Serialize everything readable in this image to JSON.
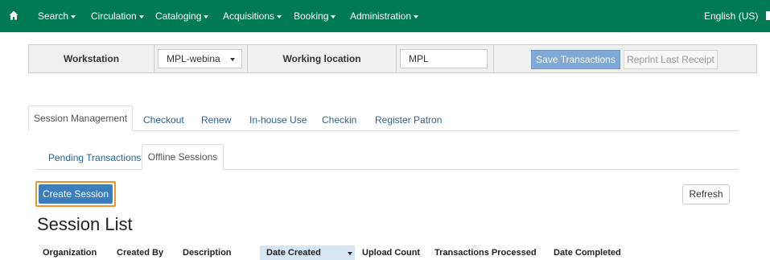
{
  "navbar": {
    "menus": [
      {
        "label": "Search"
      },
      {
        "label": "Circulation"
      },
      {
        "label": "Cataloging"
      },
      {
        "label": "Acquisitions"
      },
      {
        "label": "Booking"
      },
      {
        "label": "Administration"
      }
    ],
    "language": "English (US)"
  },
  "workstation_bar": {
    "workstation_label": "Workstation",
    "workstation_value": "MPL-webina",
    "working_location_label": "Working location",
    "working_location_value": "MPL",
    "save_button": "Save Transactions",
    "reprint_button": "Reprint Last Receipt"
  },
  "main_tabs": [
    {
      "label": "Session Management",
      "active": true
    },
    {
      "label": "Checkout"
    },
    {
      "label": "Renew"
    },
    {
      "label": "In-house Use"
    },
    {
      "label": "Checkin"
    },
    {
      "label": "Register Patron"
    }
  ],
  "sub_tabs": [
    {
      "label": "Pending Transactions"
    },
    {
      "label": "Offline Sessions",
      "active": true
    }
  ],
  "create_button": "Create Session",
  "refresh_button": "Refresh",
  "section_title": "Session List",
  "table": {
    "columns": [
      "Organization",
      "Created By",
      "Description",
      "Date Created",
      "Upload Count",
      "Transactions Processed",
      "Date Completed"
    ],
    "sorted_column": "Date Created"
  },
  "colors": {
    "navbar": "#007a54",
    "primary": "#3a7ebf",
    "highlight_outline": "#f0932b",
    "link": "#2a6496"
  }
}
